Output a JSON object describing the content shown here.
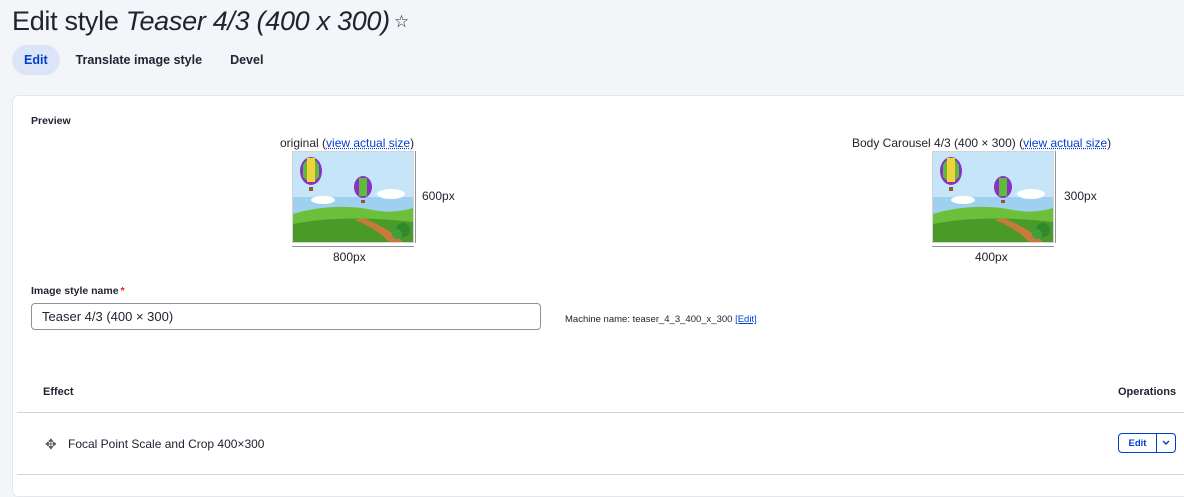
{
  "header": {
    "title_prefix": "Edit style",
    "title_style": "Teaser 4/3 (400 x 300)",
    "star_icon": "☆"
  },
  "tabs": [
    {
      "label": "Edit",
      "active": true
    },
    {
      "label": "Translate image style",
      "active": false
    },
    {
      "label": "Devel",
      "active": false
    }
  ],
  "preview": {
    "label": "Preview",
    "original": {
      "caption_prefix": "original (",
      "link": "view actual size",
      "caption_suffix": ")",
      "height_label": "600px",
      "width_label": "800px"
    },
    "derivative": {
      "caption_prefix": "Body Carousel 4/3 (400 × 300) (",
      "link": "view actual size",
      "caption_suffix": ")",
      "height_label": "300px",
      "width_label": "400px"
    }
  },
  "form": {
    "name_label": "Image style name",
    "required_mark": "*",
    "name_value": "Teaser 4/3 (400 × 300)",
    "machine_name_text": "Machine name: teaser_4_3_400_x_300",
    "machine_edit_link": "[Edit]"
  },
  "table": {
    "col_effect": "Effect",
    "col_operations": "Operations",
    "rows": [
      {
        "effect": "Focal Point Scale and Crop 400×300",
        "op_label": "Edit",
        "drag_icon": "✥"
      }
    ]
  },
  "colors": {
    "accent": "#003ecc",
    "active_tab_bg": "#dbe5f7",
    "required": "#dc2323"
  }
}
